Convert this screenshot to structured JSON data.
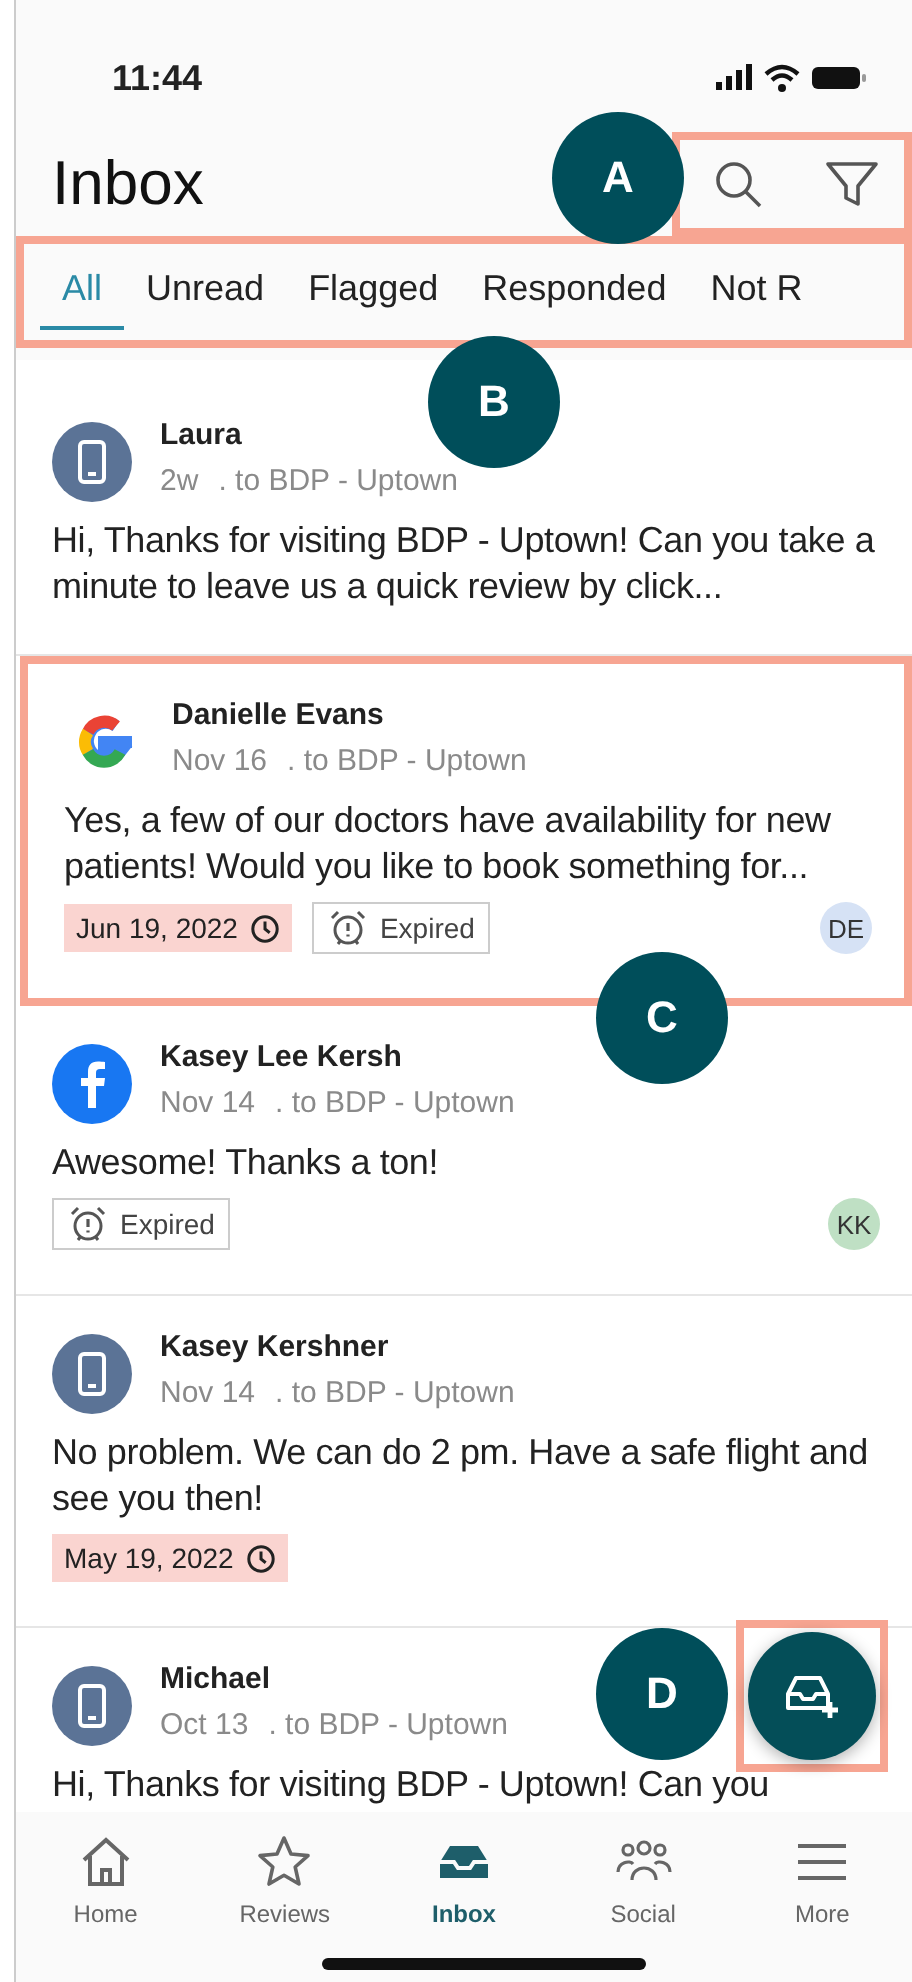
{
  "status_bar": {
    "time": "11:44"
  },
  "header": {
    "title": "Inbox",
    "actions_highlighted": true,
    "actions_callout": "A"
  },
  "tabs": {
    "highlighted": true,
    "callout": "B",
    "items": [
      {
        "label": "All",
        "selected": true
      },
      {
        "label": "Unread",
        "selected": false
      },
      {
        "label": "Flagged",
        "selected": false
      },
      {
        "label": "Responded",
        "selected": false
      },
      {
        "label": "Not R",
        "selected": false
      }
    ]
  },
  "messages": [
    {
      "kind": "phone",
      "name": "Laura",
      "time": "2w",
      "recipient": ". to BDP - Uptown",
      "body": "Hi, Thanks for visiting BDP - Uptown! Can you take a minute to leave us a quick review by click...",
      "highlighted": false
    },
    {
      "kind": "google",
      "name": "Danielle Evans",
      "time": "Nov 16",
      "recipient": ". to BDP - Uptown",
      "body": "Yes, a few of our doctors have availability for new patients! Would you like to book something for...",
      "due": "Jun 19, 2022",
      "expired": "Expired",
      "assignee": {
        "initials": "DE",
        "color": "#d6e2f5"
      },
      "highlighted": true,
      "callout": "C"
    },
    {
      "kind": "facebook",
      "name": "Kasey Lee Kersh",
      "time": "Nov 14",
      "recipient": ". to BDP - Uptown",
      "body": "Awesome! Thanks a ton!",
      "expired": "Expired",
      "assignee": {
        "initials": "KK",
        "color": "#bfe0c4"
      },
      "highlighted": false
    },
    {
      "kind": "phone",
      "name": "Kasey Kershner",
      "time": "Nov 14",
      "recipient": ". to BDP - Uptown",
      "body": "No problem. We can do 2 pm. Have a safe flight and see you then!",
      "due": "May 19, 2022",
      "highlighted": false
    },
    {
      "kind": "phone",
      "name": "Michael",
      "time": "Oct 13",
      "recipient": ". to BDP - Uptown",
      "body": "Hi, Thanks for visiting BDP - Uptown! Can you",
      "highlighted": false
    }
  ],
  "fab": {
    "highlighted": true,
    "callout": "D"
  },
  "nav": [
    {
      "kind": "home",
      "label": "Home",
      "selected": false
    },
    {
      "kind": "star",
      "label": "Reviews",
      "selected": false
    },
    {
      "kind": "inbox",
      "label": "Inbox",
      "selected": true
    },
    {
      "kind": "people",
      "label": "Social",
      "selected": false
    },
    {
      "kind": "menu",
      "label": "More",
      "selected": false
    }
  ]
}
